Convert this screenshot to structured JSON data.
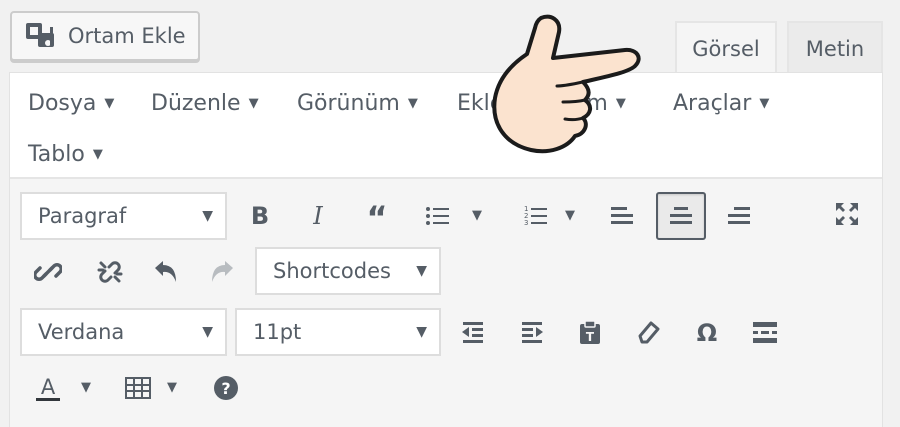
{
  "media_button": {
    "label": "Ortam Ekle",
    "icon": "media-icon"
  },
  "tabs": [
    {
      "label": "Görsel",
      "active": true
    },
    {
      "label": "Metin",
      "active": false
    }
  ],
  "menubar": {
    "items": [
      {
        "label": "Dosya"
      },
      {
        "label": "Düzenle"
      },
      {
        "label": "Görünüm"
      },
      {
        "label": "Ekle"
      },
      {
        "label": "Biçim"
      },
      {
        "label": "Araçlar"
      },
      {
        "label": "Tablo"
      }
    ]
  },
  "toolbar": {
    "format_select": {
      "value": "Paragraf"
    },
    "shortcodes_select": {
      "value": "Shortcodes"
    },
    "font_select": {
      "value": "Verdana"
    },
    "size_select": {
      "value": "11pt"
    }
  },
  "colors": {
    "text": "#555d66",
    "toolbar_bg": "#f5f5f5",
    "hand_fill": "#fbe3cf"
  }
}
